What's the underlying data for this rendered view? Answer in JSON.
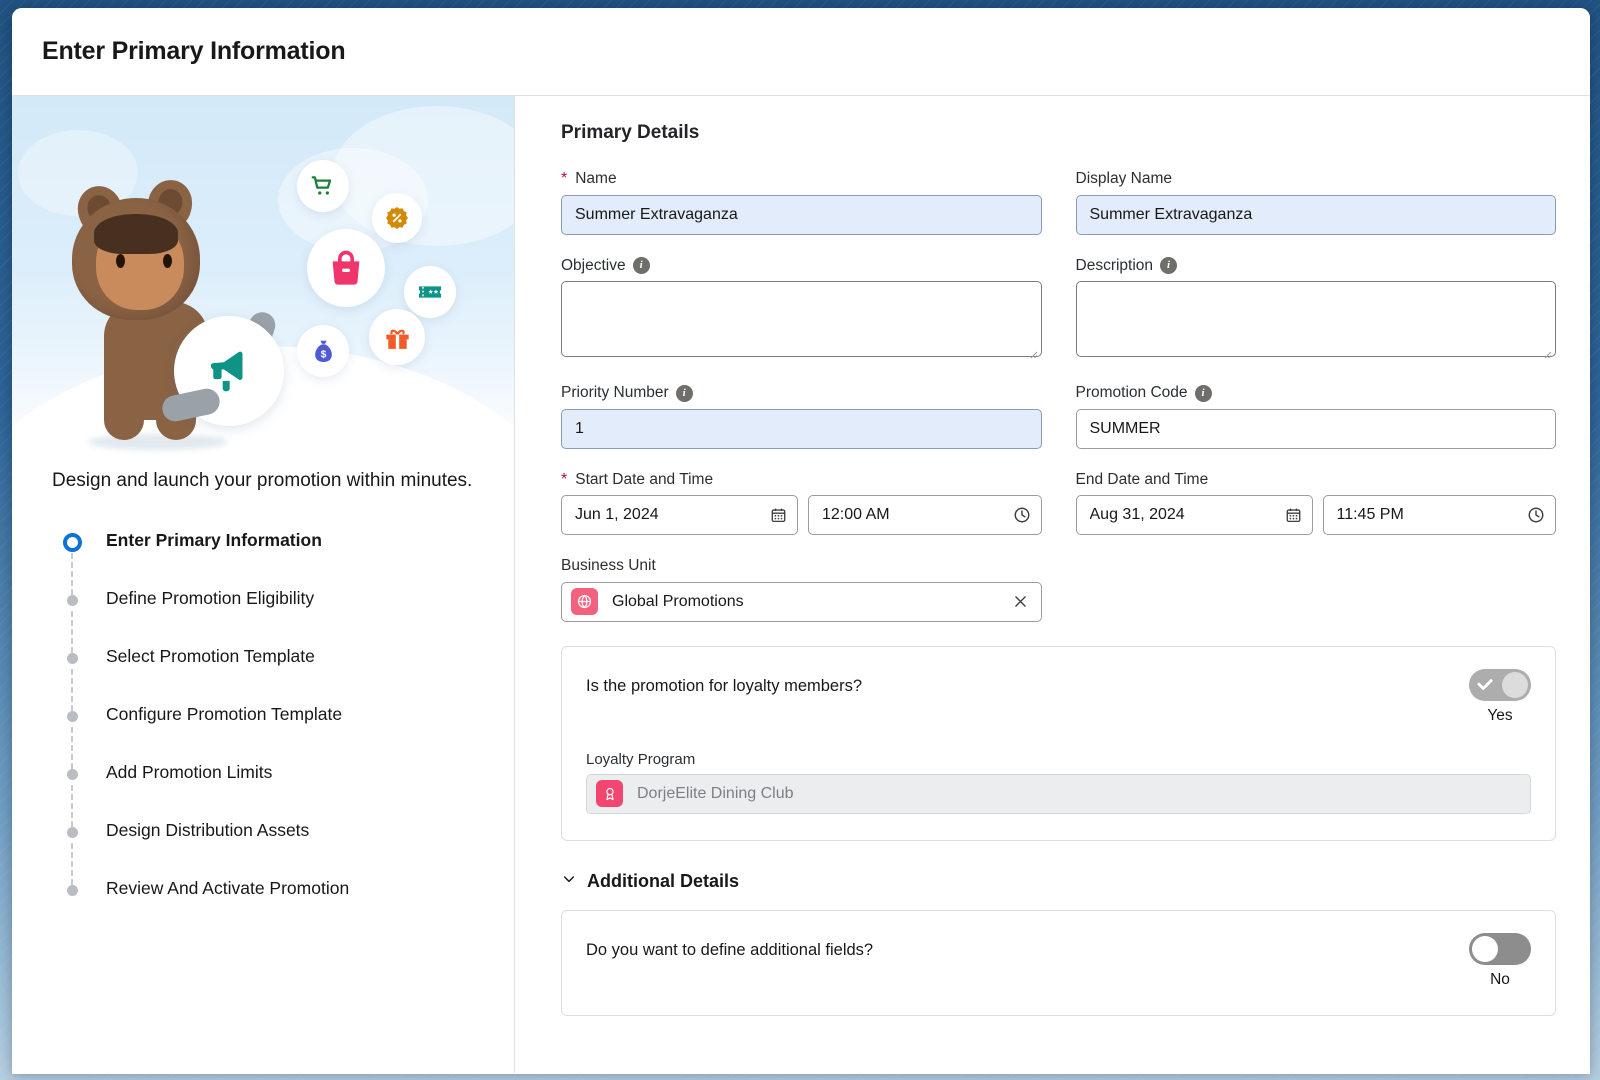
{
  "header": {
    "title": "Enter Primary Information"
  },
  "left_panel": {
    "caption": "Design and launch your promotion within minutes.",
    "bubbles": [
      {
        "icon": "shopping-cart-icon",
        "color": "#1a7f37"
      },
      {
        "icon": "percent-badge-icon",
        "color": "#d18b07"
      },
      {
        "icon": "shopping-bag-icon",
        "color": "#f0346c"
      },
      {
        "icon": "ticket-icon",
        "color": "#0d9488"
      },
      {
        "icon": "money-bag-icon",
        "color": "#4f5bd5"
      },
      {
        "icon": "gift-icon",
        "color": "#f15a29"
      }
    ],
    "mascot_icon": "megaphone-icon",
    "steps": [
      {
        "label": "Enter Primary Information",
        "state": "active"
      },
      {
        "label": "Define Promotion Eligibility",
        "state": "pending"
      },
      {
        "label": "Select Promotion Template",
        "state": "pending"
      },
      {
        "label": "Configure Promotion Template",
        "state": "pending"
      },
      {
        "label": "Add Promotion Limits",
        "state": "pending"
      },
      {
        "label": "Design Distribution Assets",
        "state": "pending"
      },
      {
        "label": "Review And Activate Promotion",
        "state": "pending"
      }
    ]
  },
  "form": {
    "section_title": "Primary Details",
    "name": {
      "label": "Name",
      "required": true,
      "value": "Summer Extravaganza",
      "placeholder": ""
    },
    "display_name": {
      "label": "Display Name",
      "required": false,
      "value": "Summer Extravaganza",
      "placeholder": ""
    },
    "objective": {
      "label": "Objective",
      "has_info": true,
      "value": "",
      "placeholder": ""
    },
    "description": {
      "label": "Description",
      "has_info": true,
      "value": "",
      "placeholder": ""
    },
    "priority_number": {
      "label": "Priority Number",
      "has_info": true,
      "value": "1",
      "placeholder": ""
    },
    "promotion_code": {
      "label": "Promotion Code",
      "has_info": true,
      "value": "SUMMER",
      "placeholder": ""
    },
    "start_date_time": {
      "label": "Start Date and Time",
      "required": true,
      "date_value": "Jun 1, 2024",
      "time_value": "12:00 AM",
      "date_icon": "calendar-icon",
      "time_icon": "clock-icon"
    },
    "end_date_time": {
      "label": "End Date and Time",
      "required": false,
      "date_value": "Aug 31, 2024",
      "time_value": "11:45 PM",
      "date_icon": "calendar-icon",
      "time_icon": "clock-icon"
    },
    "business_unit": {
      "label": "Business Unit",
      "value": "Global Promotions",
      "badge_icon": "globe-icon",
      "badge_color": "#f2627f",
      "clear_icon": "close-icon"
    },
    "loyalty_panel": {
      "question": "Is the promotion for loyalty members?",
      "toggle_state": "on",
      "toggle_label": "Yes",
      "program_label": "Loyalty Program",
      "program_value": "DorjeElite Dining Club",
      "program_badge_icon": "award-icon",
      "program_badge_color": "#f2456f"
    },
    "additional_details": {
      "title": "Additional Details",
      "chevron_icon": "chevron-down-icon",
      "question": "Do you want to define additional fields?",
      "toggle_state": "off",
      "toggle_label": "No"
    }
  },
  "colors": {
    "accent_blue": "#0b72d8",
    "required_red": "#b60554",
    "filled_field_bg": "#e3ecfa",
    "hero_bg": "#d3e9f8"
  }
}
